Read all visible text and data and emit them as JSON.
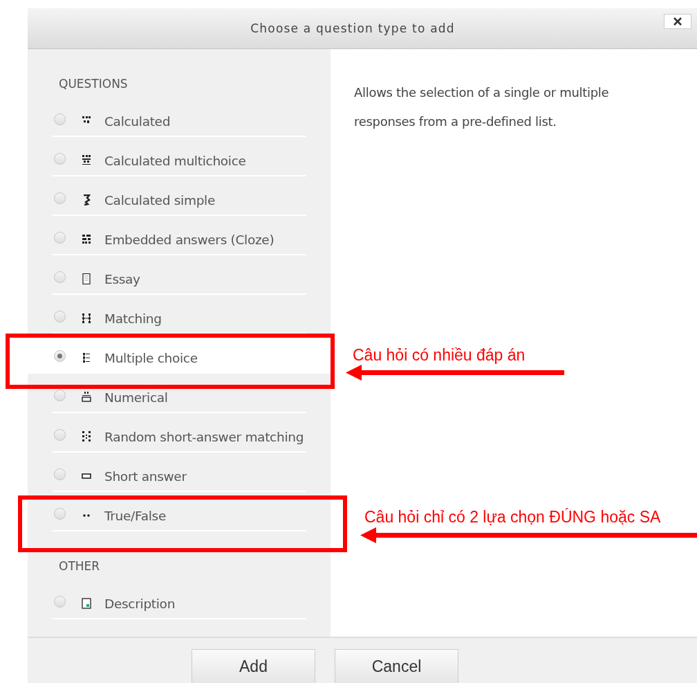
{
  "dialog": {
    "title": "Choose a question type to add"
  },
  "sections": [
    {
      "heading": "QUESTIONS",
      "items": [
        {
          "label": "Calculated",
          "selected": false
        },
        {
          "label": "Calculated multichoice",
          "selected": false
        },
        {
          "label": "Calculated simple",
          "selected": false
        },
        {
          "label": "Embedded answers (Cloze)",
          "selected": false
        },
        {
          "label": "Essay",
          "selected": false
        },
        {
          "label": "Matching",
          "selected": false
        },
        {
          "label": "Multiple choice",
          "selected": true
        },
        {
          "label": "Numerical",
          "selected": false
        },
        {
          "label": "Random short-answer matching",
          "selected": false
        },
        {
          "label": "Short answer",
          "selected": false
        },
        {
          "label": "True/False",
          "selected": false
        }
      ]
    },
    {
      "heading": "OTHER",
      "items": [
        {
          "label": "Description",
          "selected": false
        }
      ]
    }
  ],
  "description": "Allows the selection of a single or multiple responses from a pre-defined list.",
  "buttons": [
    "Add",
    "Cancel"
  ],
  "annotations": [
    {
      "text": "Câu hỏi có nhiều đáp án"
    },
    {
      "text": "Câu hỏi chỉ có 2 lựa chọn ĐÚNG hoặc SA"
    }
  ]
}
